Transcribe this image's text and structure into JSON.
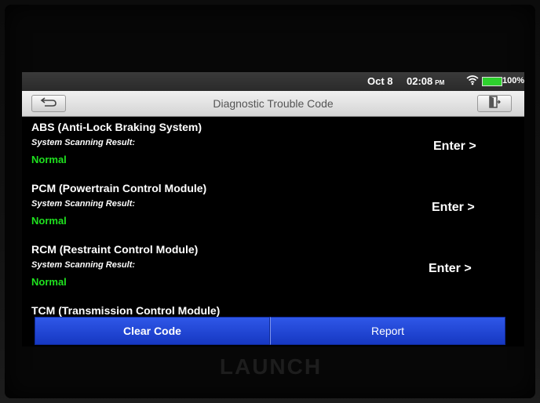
{
  "status_bar": {
    "date": "Oct 8",
    "time": "02:08",
    "ampm": "PM",
    "battery": "100%",
    "wifi_icon": "wifi-icon",
    "battery_icon": "battery-icon"
  },
  "title_bar": {
    "title": "Diagnostic Trouble Code",
    "back_icon": "back-arrow-icon",
    "exit_icon": "exit-door-icon"
  },
  "modules": [
    {
      "name": "ABS (Anti-Lock Braking System)",
      "result_label": "System Scanning Result:",
      "status": "Normal",
      "enter": "Enter >"
    },
    {
      "name": "PCM (Powertrain Control Module)",
      "result_label": "System Scanning Result:",
      "status": "Normal",
      "enter": "Enter >"
    },
    {
      "name": "RCM (Restraint Control Module)",
      "result_label": "System Scanning Result:",
      "status": "Normal",
      "enter": "Enter >"
    },
    {
      "name": "TCM (Transmission Control Module)"
    }
  ],
  "actions": {
    "clear_code": "Clear Code",
    "report": "Report"
  },
  "brand": "LAUNCH",
  "colors": {
    "normal_status": "#1fe21f",
    "action_button": "#1f45d6",
    "battery": "#2ed12e"
  }
}
